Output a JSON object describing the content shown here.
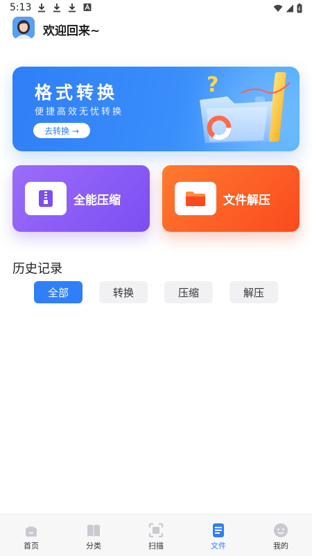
{
  "status_bar": {
    "time": "5:13",
    "icons": [
      "download-icon",
      "download-icon",
      "download-icon",
      "a-icon",
      "wifi-icon",
      "signal-icon",
      "battery-icon"
    ]
  },
  "header": {
    "welcome": "欢迎回来~"
  },
  "banner": {
    "title": "格式转换",
    "subtitle": "便捷高效无忧转换",
    "button_label": "去转换 →",
    "accent": "#2f7ff8"
  },
  "features": [
    {
      "label": "全能压缩",
      "icon": "zip-file-icon",
      "color": "#7c4ef2"
    },
    {
      "label": "文件解压",
      "icon": "folder-icon",
      "color": "#fa4a1f"
    }
  ],
  "history": {
    "title": "历史记录",
    "tabs": [
      {
        "label": "全部",
        "active": true
      },
      {
        "label": "转换",
        "active": false
      },
      {
        "label": "压缩",
        "active": false
      },
      {
        "label": "解压",
        "active": false
      }
    ]
  },
  "bottom_nav": [
    {
      "label": "首页",
      "icon": "home-icon"
    },
    {
      "label": "分类",
      "icon": "book-icon"
    },
    {
      "label": "扫描",
      "icon": "scan-icon"
    },
    {
      "label": "文件",
      "icon": "document-icon",
      "active": true
    },
    {
      "label": "我的",
      "icon": "profile-icon"
    }
  ]
}
